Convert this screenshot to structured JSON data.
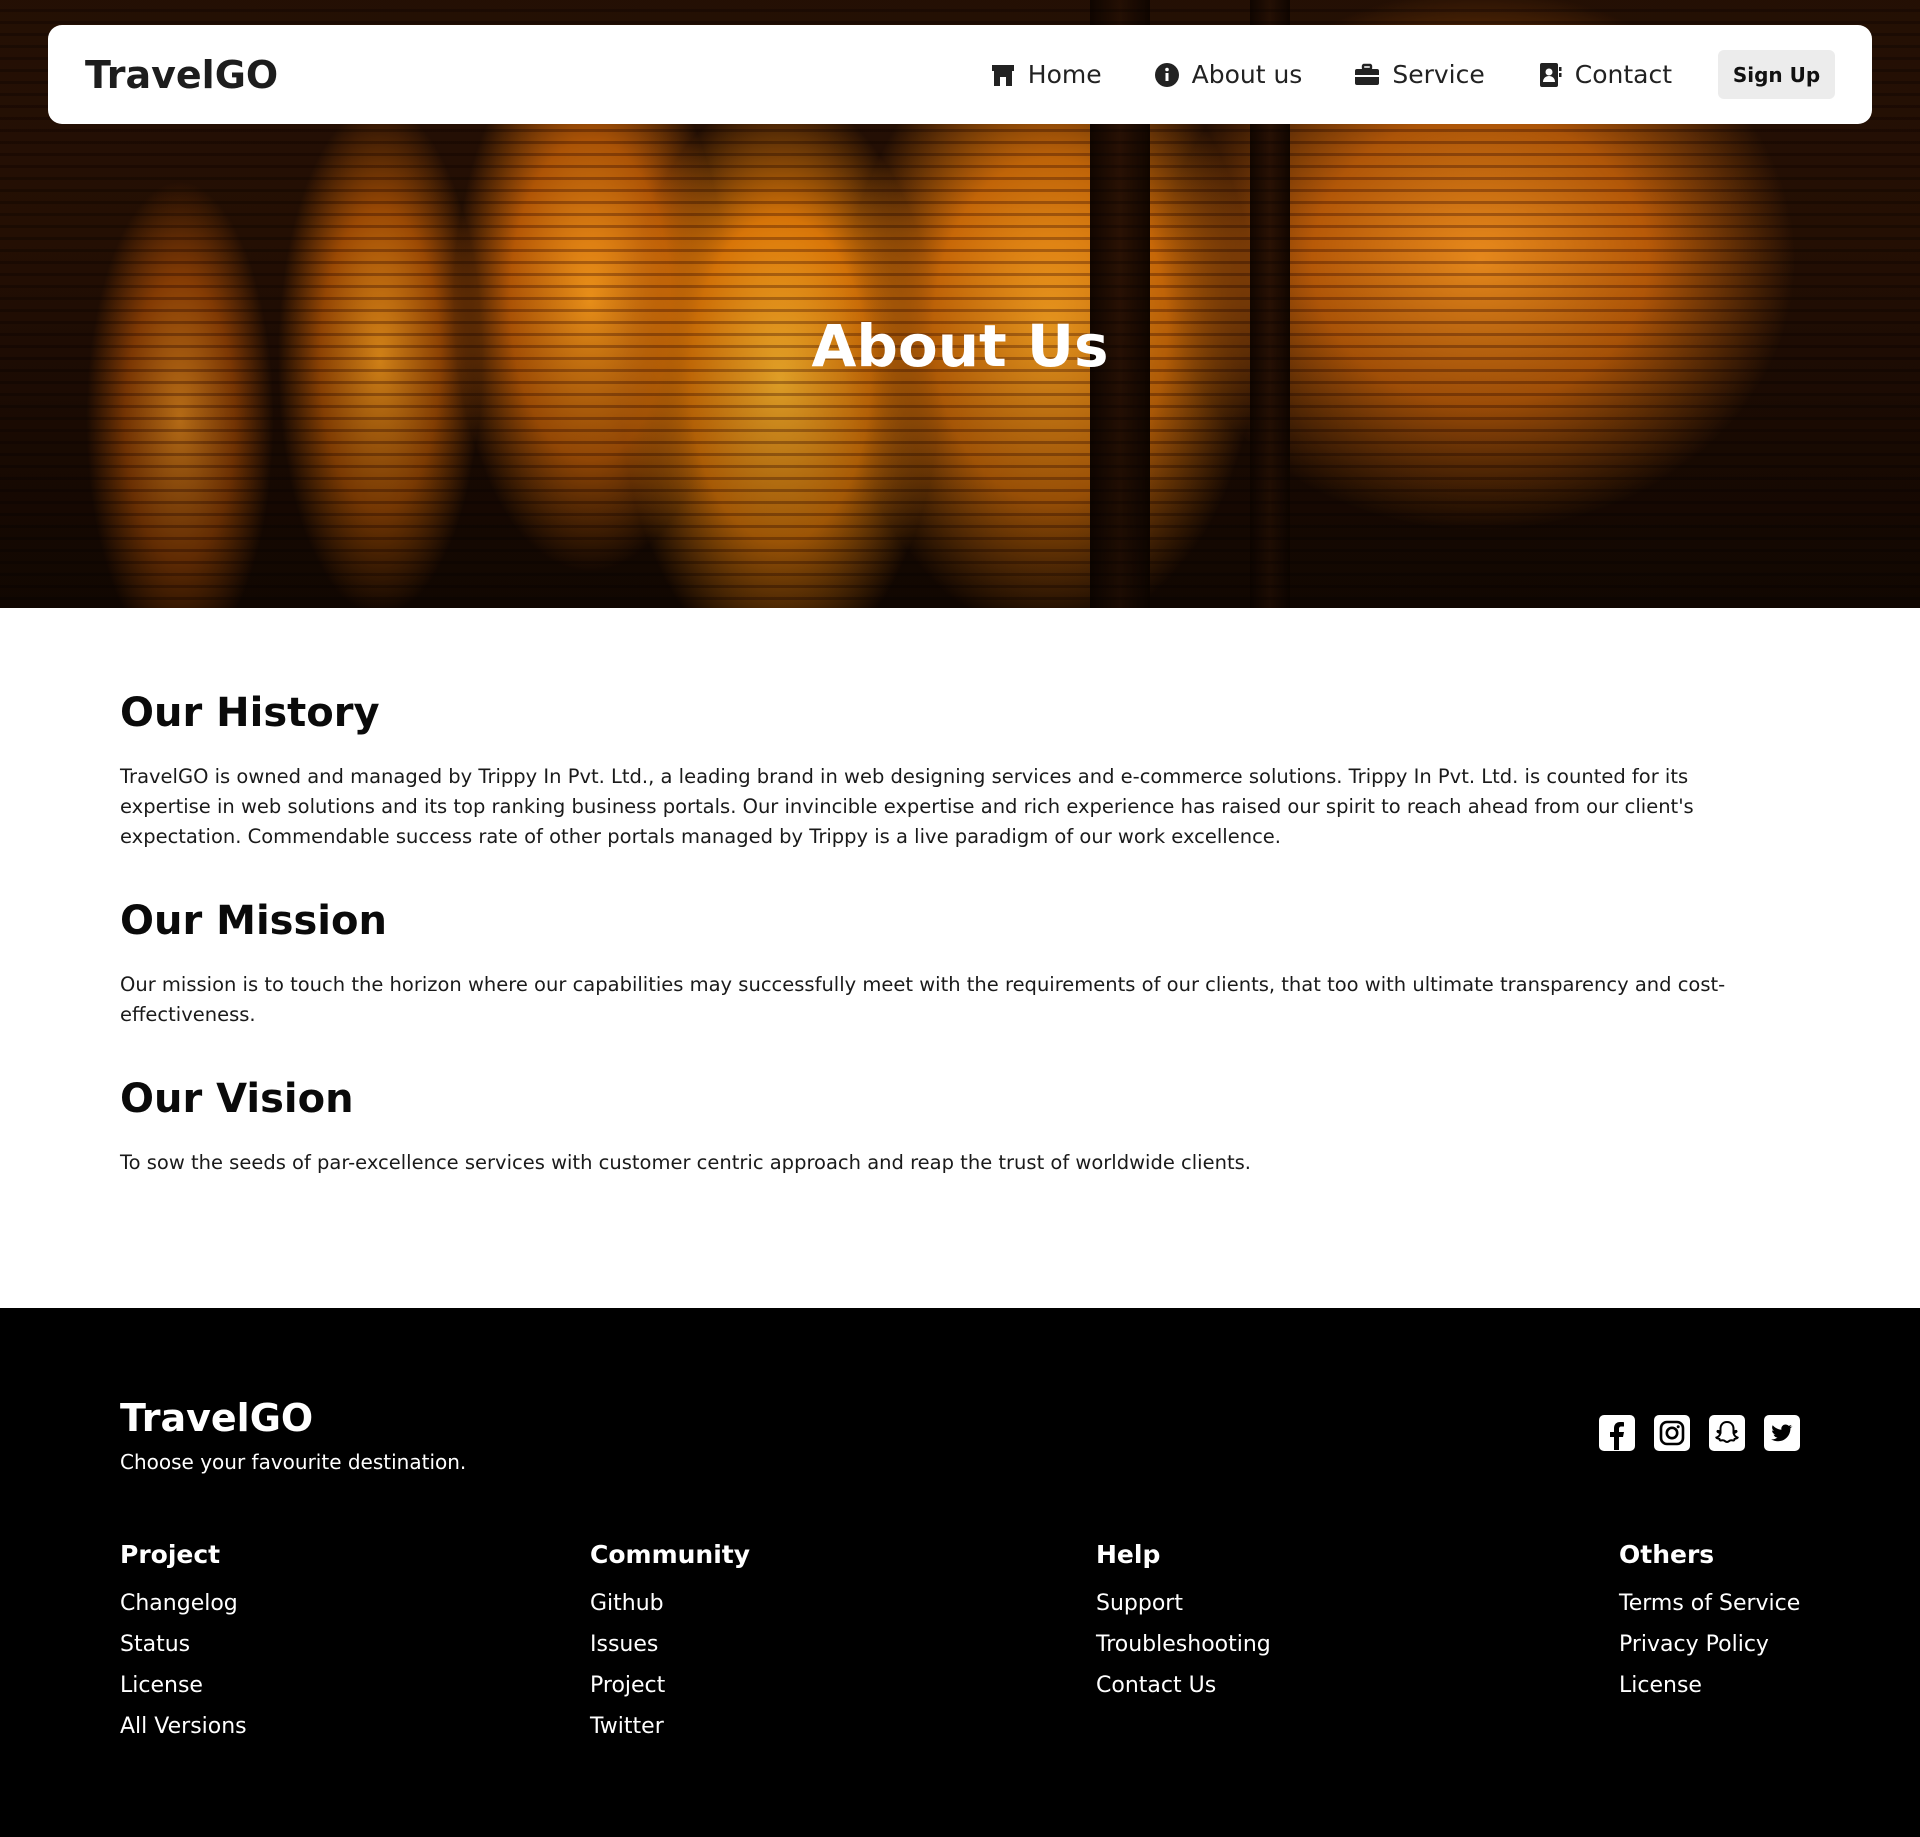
{
  "nav": {
    "brand": "TravelGO",
    "links": [
      {
        "label": "Home",
        "icon": "home-icon"
      },
      {
        "label": "About us",
        "icon": "info-icon"
      },
      {
        "label": "Service",
        "icon": "briefcase-icon"
      },
      {
        "label": "Contact",
        "icon": "contact-card-icon"
      }
    ],
    "signup_label": "Sign Up"
  },
  "hero": {
    "title": "About Us"
  },
  "sections": [
    {
      "title": "Our History",
      "body": "TravelGO is owned and managed by Trippy In Pvt. Ltd., a leading brand in web designing services and e-commerce solutions. Trippy In Pvt. Ltd. is counted for its expertise in web solutions and its top ranking business portals. Our invincible expertise and rich experience has raised our spirit to reach ahead from our client's expectation. Commendable success rate of other portals managed by Trippy is a live paradigm of our work excellence."
    },
    {
      "title": "Our Mission",
      "body": "Our mission is to touch the horizon where our capabilities may successfully meet with the requirements of our clients, that too with ultimate transparency and cost-effectiveness."
    },
    {
      "title": "Our Vision",
      "body": "To sow the seeds of par-excellence services with customer centric approach and reap the trust of worldwide clients."
    }
  ],
  "footer": {
    "brand": "TravelGO",
    "tagline": "Choose your favourite destination.",
    "socials": [
      "facebook-icon",
      "instagram-icon",
      "snapchat-icon",
      "twitter-icon"
    ],
    "columns": [
      {
        "title": "Project",
        "links": [
          "Changelog",
          "Status",
          "License",
          "All Versions"
        ]
      },
      {
        "title": "Community",
        "links": [
          "Github",
          "Issues",
          "Project",
          "Twitter"
        ]
      },
      {
        "title": "Help",
        "links": [
          "Support",
          "Troubleshooting",
          "Contact Us"
        ]
      },
      {
        "title": "Others",
        "links": [
          "Terms of Service",
          "Privacy Policy",
          "License"
        ]
      }
    ]
  },
  "colors": {
    "nav_bg": "#ffffff",
    "signup_bg": "#ececec",
    "footer_bg": "#000000",
    "hero_accent": "#e88a1c"
  }
}
